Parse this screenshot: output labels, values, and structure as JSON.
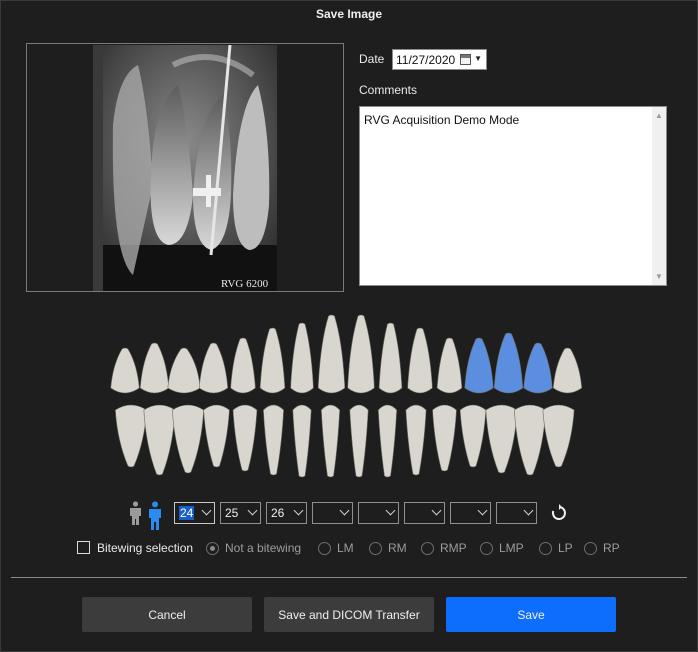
{
  "dialog": {
    "title": "Save Image"
  },
  "preview": {
    "watermark": "RVG 6200"
  },
  "date": {
    "label": "Date",
    "value": "11/27/2020"
  },
  "comments": {
    "label": "Comments",
    "value": "RVG Acquisition Demo Mode"
  },
  "tooth_selectors": [
    {
      "value": "24"
    },
    {
      "value": "25"
    },
    {
      "value": "26"
    },
    {
      "value": ""
    },
    {
      "value": ""
    },
    {
      "value": ""
    },
    {
      "value": ""
    },
    {
      "value": ""
    }
  ],
  "bitewing": {
    "checkbox_label": "Bitewing selection",
    "options": [
      {
        "label": "Not a bitewing",
        "checked": true
      },
      {
        "label": "LM",
        "checked": false
      },
      {
        "label": "RM",
        "checked": false
      },
      {
        "label": "RMP",
        "checked": false
      },
      {
        "label": "LMP",
        "checked": false
      },
      {
        "label": "LP",
        "checked": false
      },
      {
        "label": "RP",
        "checked": false
      }
    ]
  },
  "buttons": {
    "cancel": "Cancel",
    "save_dicom": "Save and DICOM Transfer",
    "save": "Save"
  },
  "colors": {
    "accent": "#0d6efd",
    "selected_tooth": "#5b8ede",
    "tooth": "#d8d6ce",
    "background": "#1e1e1e"
  },
  "selected_teeth": [
    "24",
    "25",
    "26"
  ]
}
